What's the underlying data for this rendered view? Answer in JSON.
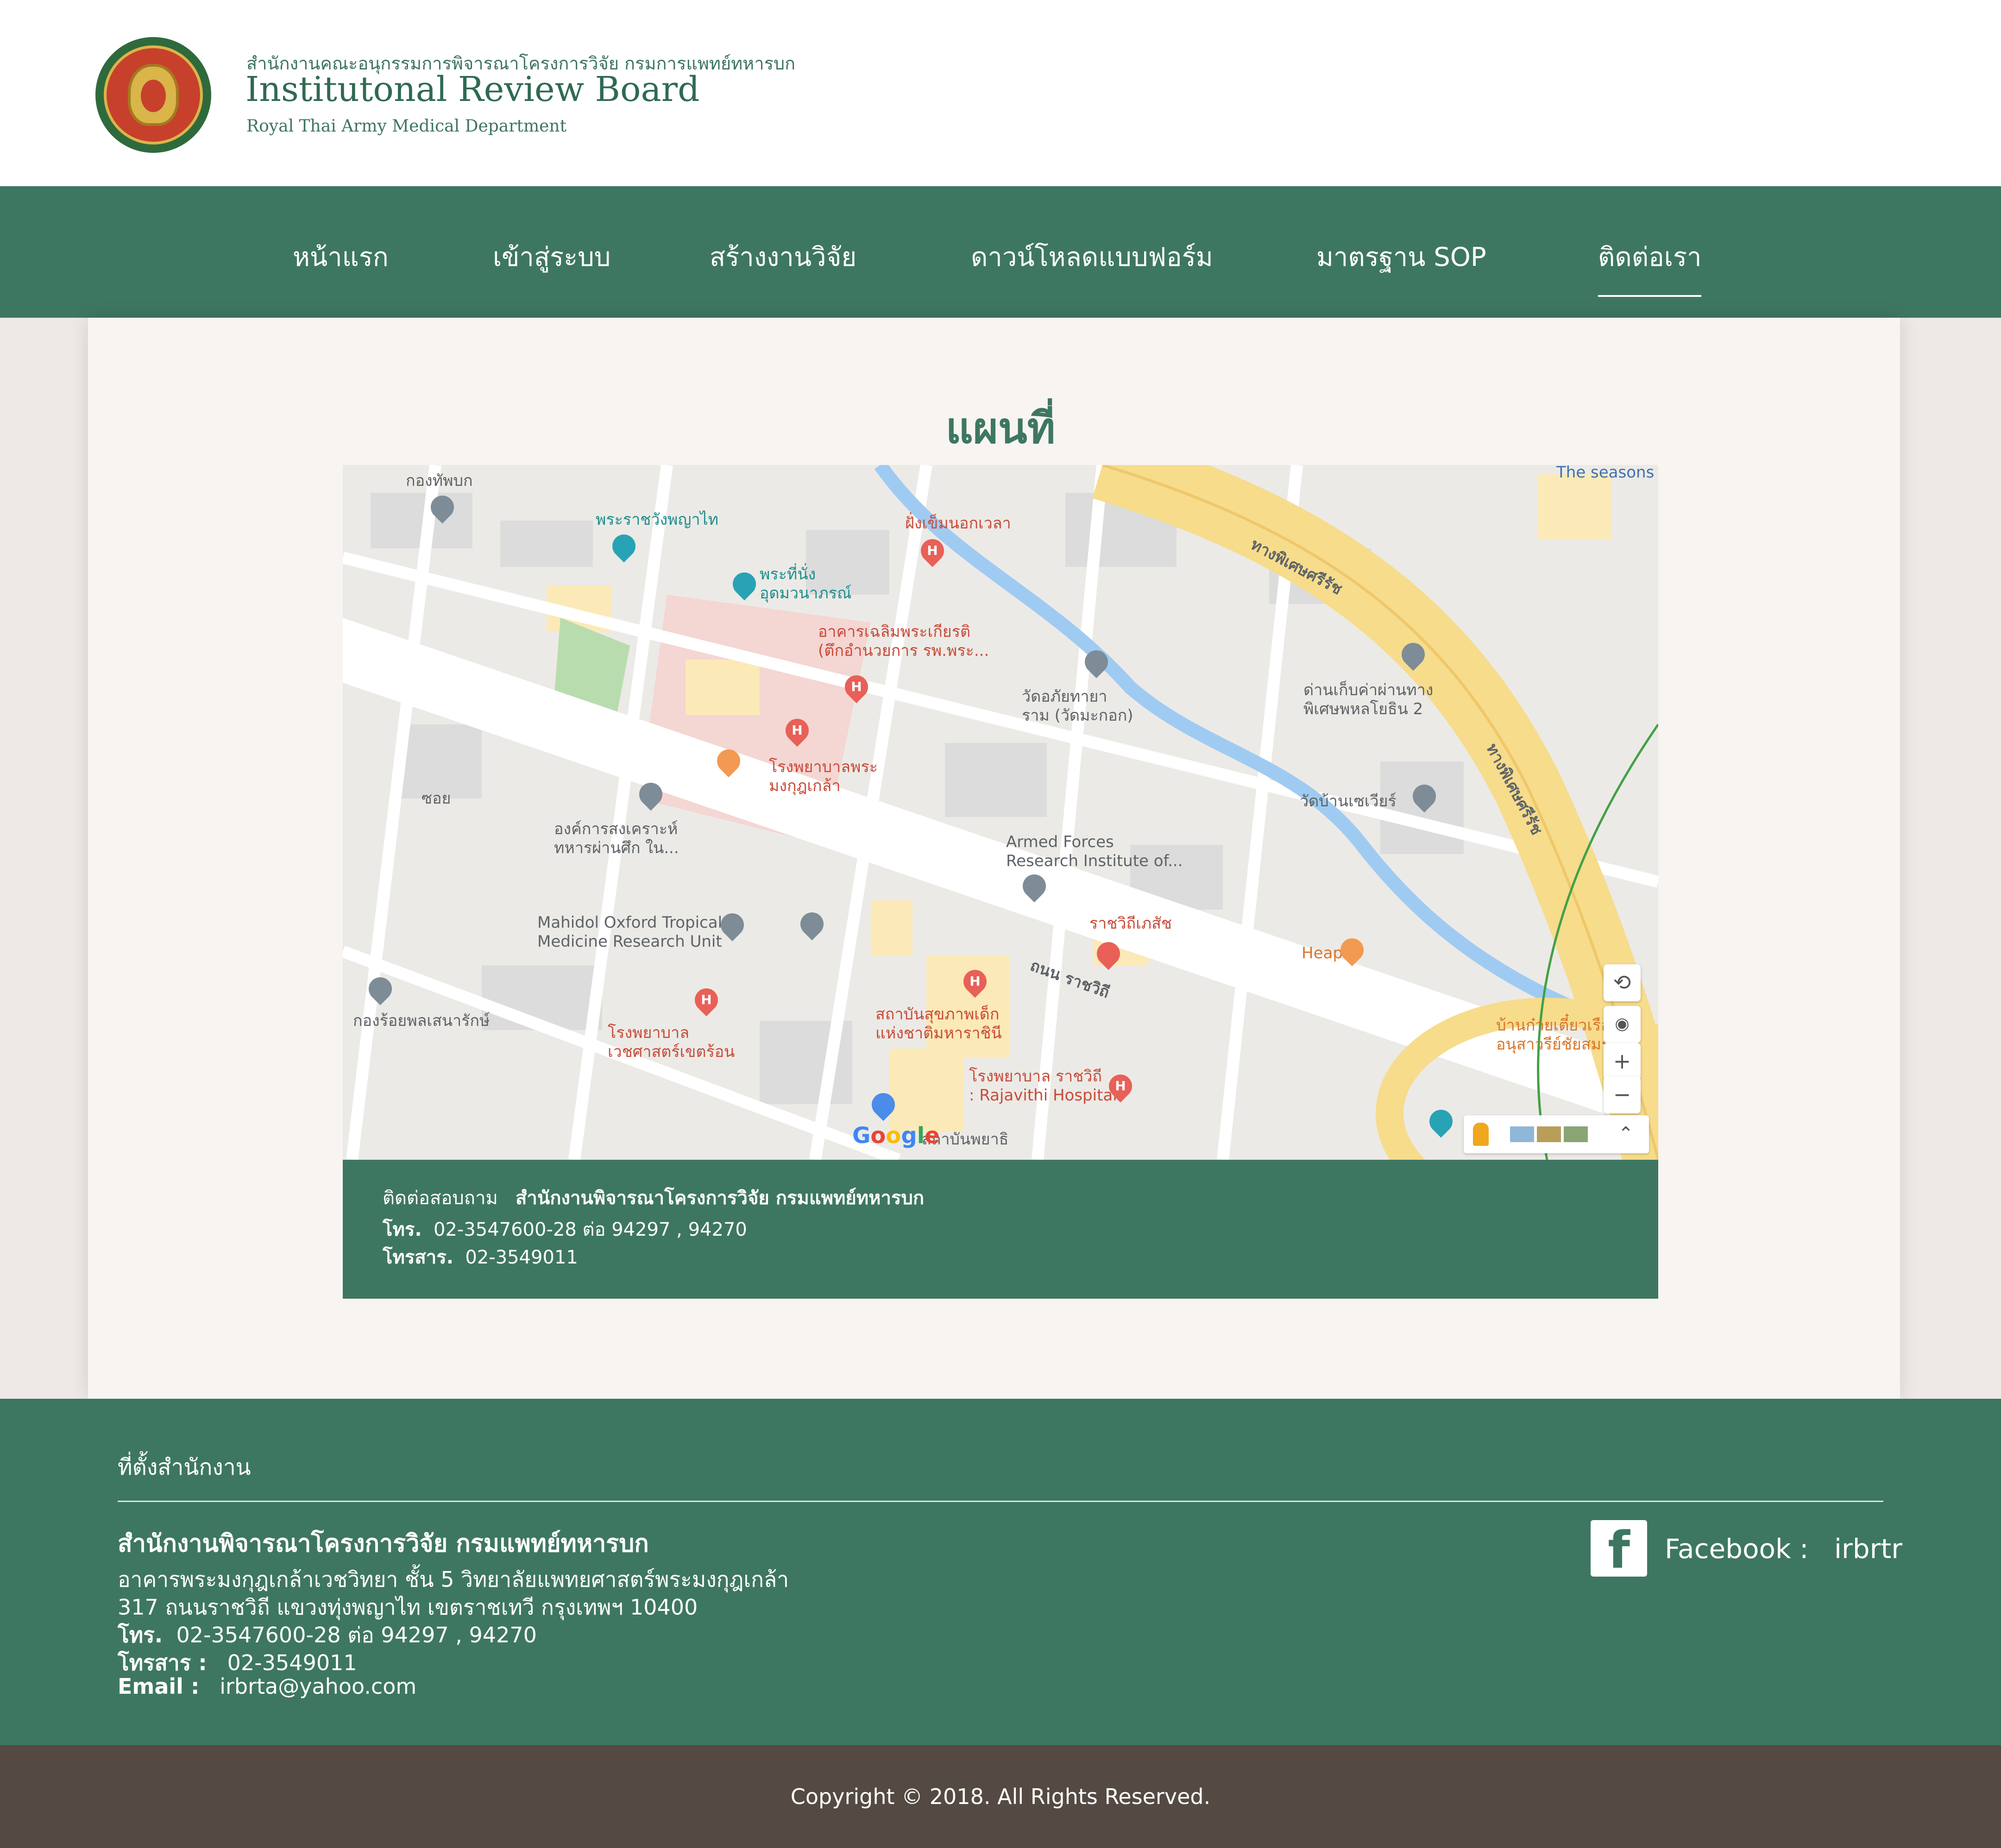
{
  "header": {
    "org_thai": "สำนักงานคณะอนุกรรมการพิจารณาโครงการวิจัย กรมการแพทย์ทหารบก",
    "org_title": "Institutonal Review Board",
    "org_sub": "Royal Thai Army Medical Department"
  },
  "nav": {
    "items": [
      "หน้าแรก",
      "เข้าสู่ระบบ",
      "สร้างงานวิจัย",
      "ดาวน์โหลดแบบฟอร์ม",
      "มาตรฐาน SOP",
      "ติดต่อเรา"
    ],
    "active": "ติดต่อเรา"
  },
  "page": {
    "title": "แผนที่"
  },
  "map": {
    "labels": {
      "a": "กองทัพบก",
      "b": "พระราชวังพญาไท",
      "c1": "พระที่นั่ง",
      "c2": "อุดมวนาภรณ์",
      "d": "ฝั่งเข็มนอกเวลา",
      "e1": "อาคารเฉลิมพระเกียรติ",
      "e2": "(ตึกอำนวยการ รพ.พระ...",
      "f1": "วัดอภัยทายา",
      "f2": "ราม (วัดมะกอก)",
      "g1": "ด่านเก็บค่าผ่านทาง",
      "g2": "พิเศษพหลโยธิน 2",
      "h": "ทางพิเศษศรีรัช",
      "h2": "ทางพิเศษศรีรัช",
      "i1": "โรงพยาบาลพระ",
      "i2": "มงกุฎเกล้า",
      "j": "วัดบ้านเซเวียร์",
      "k1": "องค์การสงเคราะห์",
      "k2": "ทหารผ่านศึก ใน...",
      "l1": "Armed Forces",
      "l2": "Research Institute of...",
      "m": "ราชวิถีเภสัช",
      "n": "Heap",
      "o1": "Mahidol Oxford Tropical",
      "o2": "Medicine Research Unit",
      "p": "ถนน ราชวิถี",
      "q": "กองร้อยพลเสนารักษ์",
      "r1": "สถาบันสุขภาพเด็ก",
      "r2": "แห่งชาติมหาราชินี",
      "s1": "โรงพยาบาล",
      "s2": "เวชศาสตร์เขตร้อน",
      "t1": "โรงพยาบาล ราชวิถี",
      "t2": ": Rajavithi Hospital",
      "u1": "บ้านก๋วยเตี๋ยวเรือ",
      "u2": "อนุสาวรีย์ชัยสมรภูมิ",
      "v": "The seasons",
      "w": "ซอย",
      "x": "สถาบันพยาธิ",
      "pin_h": "H"
    },
    "google": "Google",
    "controls": {
      "zoom_in": "+",
      "zoom_out": "−"
    }
  },
  "contact": {
    "label": "ติดต่อสอบถาม",
    "org": "สำนักงานพิจารณาโครงการวิจัย กรมแพทย์ทหารบก",
    "tel_label": "โทร.",
    "tel": "02-3547600-28   ต่อ 94297 , 94270",
    "fax_label": "โทรสาร.",
    "fax": "02-3549011"
  },
  "footer": {
    "location_title": "ที่ตั้งสำนักงาน",
    "org": "สำนักงานพิจารณาโครงการวิจัย กรมแพทย์ทหารบก",
    "addr1": "อาคารพระมงกุฎเกล้าเวชวิทยา ชั้น 5   วิทยาลัยแพทยศาสตร์พระมงกุฎเกล้า",
    "addr2": "317 ถนนราชวิถี แขวงทุ่งพญาไท เขตราชเทวี กรุงเทพฯ 10400",
    "tel_label": "โทร.",
    "tel": "02-3547600-28   ต่อ 94297 , 94270",
    "fax_label": "โทรสาร :",
    "fax": "02-3549011",
    "email_label": "Email :",
    "email": "irbrta@yahoo.com",
    "facebook_label": "Facebook :",
    "facebook_value": "irbrtr",
    "copyright": "Copyright © 2018. All Rights Reserved."
  }
}
